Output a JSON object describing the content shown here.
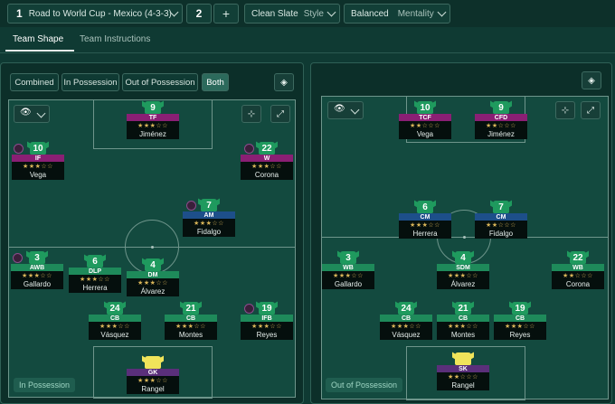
{
  "topbar": {
    "tactic_slot": "1",
    "tactic_name": "Road to World Cup - Mexico (4-3-3)",
    "slot_count": "2",
    "add_label": "+",
    "style_value": "Clean Slate",
    "style_label": "Style",
    "mentality_value": "Balanced",
    "mentality_label": "Mentality"
  },
  "tabs": [
    {
      "label": "Team Shape"
    },
    {
      "label": "Team Instructions"
    }
  ],
  "mode_buttons": [
    {
      "label": "Combined"
    },
    {
      "label": "In Possession"
    },
    {
      "label": "Out of Possession"
    },
    {
      "label": "Both"
    }
  ],
  "left_panel": {
    "label": "In Possession",
    "players": [
      {
        "num": "9",
        "role": "TF",
        "stars": "★★★☆☆",
        "name": "Jiménez"
      },
      {
        "num": "10",
        "role": "IF",
        "stars": "★★★☆☆",
        "name": "Vega"
      },
      {
        "num": "22",
        "role": "W",
        "stars": "★★★☆☆",
        "name": "Corona"
      },
      {
        "num": "7",
        "role": "AM",
        "stars": "★★★☆☆",
        "name": "Fidalgo"
      },
      {
        "num": "3",
        "role": "AWB",
        "stars": "★★★☆☆",
        "name": "Gallardo"
      },
      {
        "num": "6",
        "role": "DLP",
        "stars": "★★★☆☆",
        "name": "Herrera"
      },
      {
        "num": "4",
        "role": "DM",
        "stars": "★★★☆☆",
        "name": "Álvarez"
      },
      {
        "num": "24",
        "role": "CB",
        "stars": "★★★☆☆",
        "name": "Vásquez"
      },
      {
        "num": "21",
        "role": "CB",
        "stars": "★★★☆☆",
        "name": "Montes"
      },
      {
        "num": "19",
        "role": "IFB",
        "stars": "★★★☆☆",
        "name": "Reyes"
      },
      {
        "num": "",
        "role": "GK",
        "stars": "★★★☆☆",
        "name": "Rangel"
      }
    ]
  },
  "right_panel": {
    "label": "Out of Possession",
    "players": [
      {
        "num": "10",
        "role": "TCF",
        "stars": "★★☆☆☆",
        "name": "Vega"
      },
      {
        "num": "9",
        "role": "CFD",
        "stars": "★★☆☆☆",
        "name": "Jiménez"
      },
      {
        "num": "6",
        "role": "CM",
        "stars": "★★★☆☆",
        "name": "Herrera"
      },
      {
        "num": "7",
        "role": "CM",
        "stars": "★★☆☆☆",
        "name": "Fidalgo"
      },
      {
        "num": "3",
        "role": "WB",
        "stars": "★★★☆☆",
        "name": "Gallardo"
      },
      {
        "num": "4",
        "role": "SDM",
        "stars": "★★★☆☆",
        "name": "Álvarez"
      },
      {
        "num": "22",
        "role": "WB",
        "stars": "★★☆☆☆",
        "name": "Corona"
      },
      {
        "num": "24",
        "role": "CB",
        "stars": "★★★☆☆",
        "name": "Vásquez"
      },
      {
        "num": "21",
        "role": "CB",
        "stars": "★★★☆☆",
        "name": "Montes"
      },
      {
        "num": "19",
        "role": "CB",
        "stars": "★★★☆☆",
        "name": "Reyes"
      },
      {
        "num": "",
        "role": "SK",
        "stars": "★★☆☆☆",
        "name": "Rangel"
      }
    ]
  },
  "colors": {
    "attack": "#8a1f74",
    "midfield": "#1d4f8a",
    "defense": "#1e8a5a",
    "keeper": "#5a2f7a",
    "shirt_green": "#1f9a5e",
    "shirt_keeper": "#f0e45a"
  }
}
